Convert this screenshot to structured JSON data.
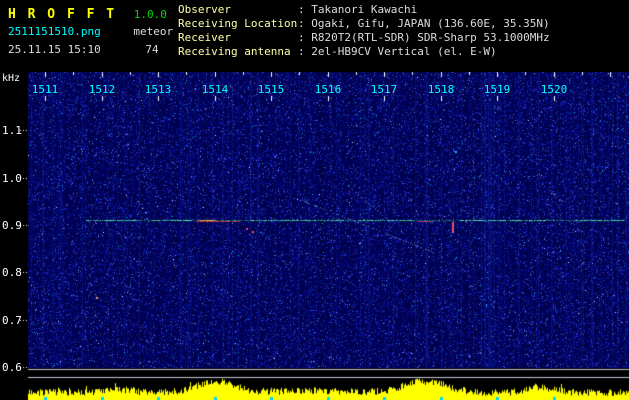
{
  "header": {
    "app_name": "H R O F F T",
    "version": "1.0.0",
    "filename": "2511151510.png",
    "mode": "meteor",
    "datetime": "25.11.15 15:10",
    "echo_count": "74",
    "info": [
      {
        "label": "Observer",
        "value": ": Takanori Kawachi"
      },
      {
        "label": "Receiving Location",
        "value": ": Ogaki, Gifu, JAPAN (136.60E, 35.35N)"
      },
      {
        "label": "Receiver",
        "value": ": R820T2(RTL-SDR) SDR-Sharp 53.1000MHz"
      },
      {
        "label": "Receiving antenna",
        "value": ": 2el-HB9CV Vertical (el. E-W)"
      }
    ]
  },
  "chart_data": {
    "type": "heatmap",
    "title": "",
    "xlabel": "",
    "ylabel": "kHz",
    "x_ticks": [
      "1511",
      "1512",
      "1513",
      "1514",
      "1515",
      "1516",
      "1517",
      "1518",
      "1519",
      "1520"
    ],
    "y_ticks": [
      "1.1",
      "1.0",
      "0.9",
      "0.8",
      "0.7",
      "0.6"
    ],
    "y_range_khz": [
      0.6,
      1.18
    ],
    "grid": false,
    "legend_position": "none",
    "features": [
      "dense blue random noise field across the full band and time span",
      "continuous echo/carrier trace at ~0.91 kHz spanning 1511-1520, mostly green/cyan",
      "red doppler-shifted segments on the trace near 1514 and 1517-1518, short red vertical dash near 1518",
      "faint cyan diagonal doppler streaks descending between 1516 and 1518",
      "two thin white horizontal lines just below the 0.6 kHz level",
      "yellow signal-level strip along the bottom with bursts near 1514 and 1518"
    ]
  },
  "colors": {
    "background": "#000000",
    "title_yellow": "#ffff00",
    "version_green": "#00dd00",
    "filename_cyan": "#00ffff",
    "text_white": "#dcdcdc",
    "label_yellow": "#ffffa8",
    "xtick_cyan": "#00ffff",
    "ytick_white": "#ffffff",
    "noise_base": "#000050",
    "trace_green": "#2ed282",
    "trace_red": "#ff4646",
    "gridline_white": "#c8c8d8",
    "amplitude_yellow": "#ffff00"
  }
}
